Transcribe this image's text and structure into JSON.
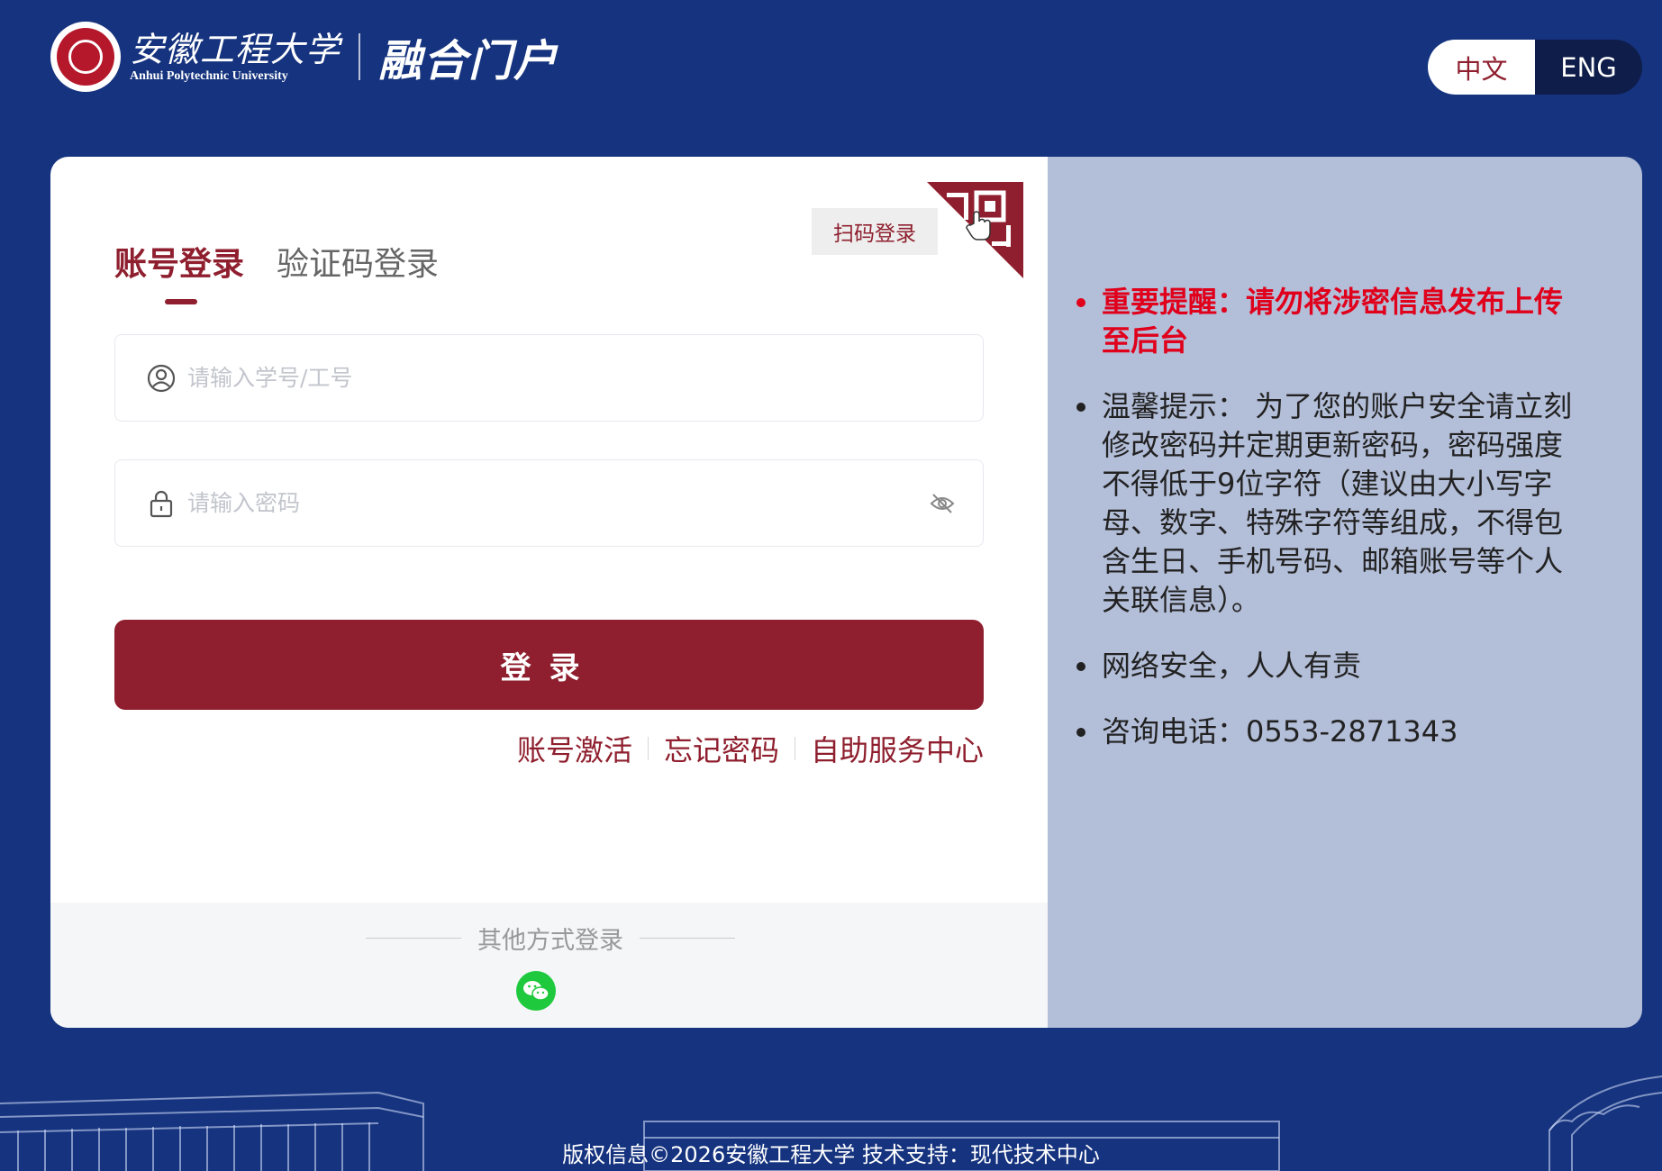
{
  "header": {
    "university_cn": "安徽工程大学",
    "university_en": "Anhui Polytechnic University",
    "portal_name": "融合门户",
    "lang_zh": "中文",
    "lang_en": "ENG"
  },
  "login": {
    "tabs": [
      {
        "label": "账号登录",
        "active": true
      },
      {
        "label": "验证码登录",
        "active": false
      }
    ],
    "qr_tip": "扫码登录",
    "username_placeholder": "请输入学号/工号",
    "password_placeholder": "请输入密码",
    "submit_label": "登录",
    "links": [
      "账号激活",
      "忘记密码",
      "自助服务中心"
    ],
    "other_methods_label": "其他方式登录"
  },
  "notices": [
    {
      "text": "重要提醒：请勿将涉密信息发布上传至后台",
      "important": true
    },
    {
      "text": "温馨提示： 为了您的账户安全请立刻修改密码并定期更新密码，密码强度不得低于9位字符（建议由大小写字母、数字、特殊字符等组成，不得包含生日、手机号码、邮箱账号等个人关联信息）。",
      "important": false
    },
    {
      "text": "网络安全，人人有责",
      "important": false
    },
    {
      "text": "咨询电话：0553-2871343",
      "important": false
    }
  ],
  "footer": {
    "copyright": "版权信息©2026安徽工程大学 技术支持：现代技术中心"
  },
  "colors": {
    "background": "#15337e",
    "brand": "#8f1f2e",
    "notice_panel": "#b3bed8",
    "important": "#e0001b",
    "wechat": "#1ec93d"
  },
  "icons": [
    "university-seal-icon",
    "user-icon",
    "lock-icon",
    "eye-off-icon",
    "qr-code-icon",
    "wechat-icon"
  ]
}
